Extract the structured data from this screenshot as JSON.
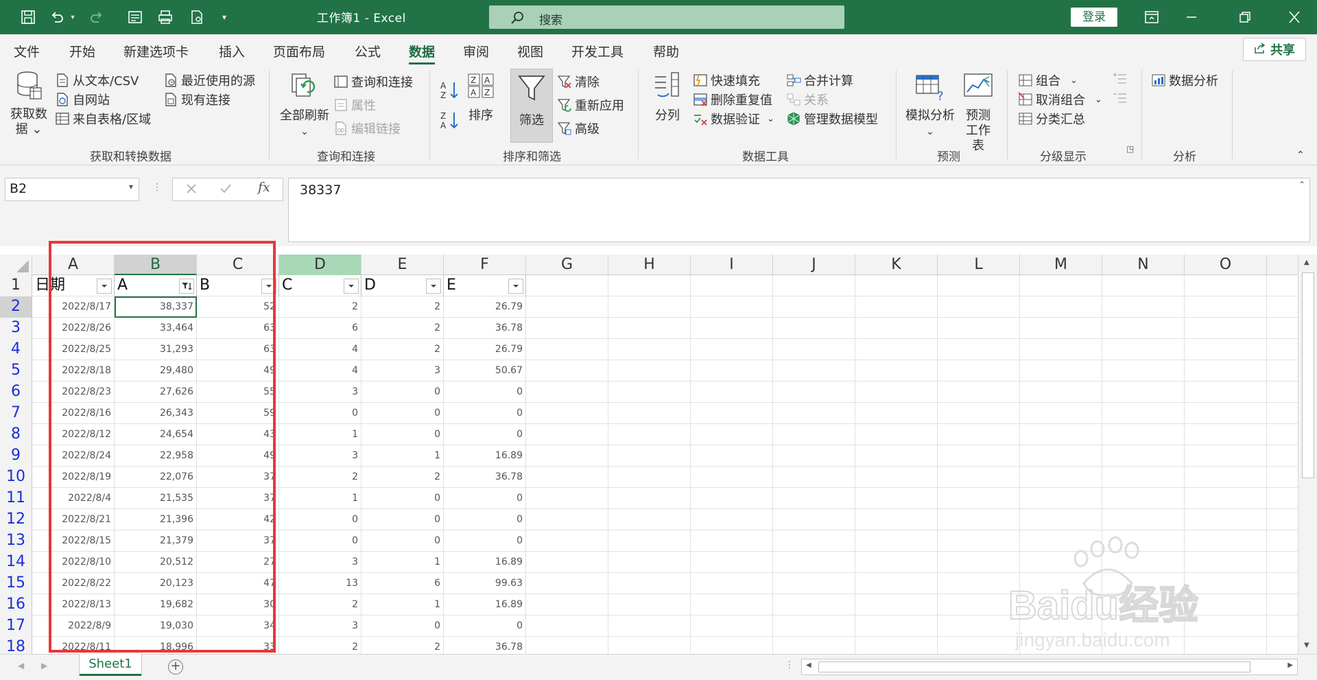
{
  "titlebar": {
    "doc_title": "工作簿1  -  Excel",
    "search_placeholder": "搜索",
    "login": "登录"
  },
  "tabs": [
    "文件",
    "开始",
    "新建选项卡",
    "插入",
    "页面布局",
    "公式",
    "数据",
    "审阅",
    "视图",
    "开发工具",
    "帮助"
  ],
  "active_tab": "数据",
  "share": "共享",
  "ribbon": {
    "get_data": "获取数\n据",
    "from_text": "从文本/CSV",
    "from_web": "自网站",
    "from_table": "来自表格/区域",
    "recent_sources": "最近使用的源",
    "existing_conn": "现有连接",
    "group_get": "获取和转换数据",
    "refresh_all": "全部刷新",
    "queries_conn": "查询和连接",
    "properties": "属性",
    "edit_links": "编辑链接",
    "group_query": "查询和连接",
    "sort": "排序",
    "filter": "筛选",
    "clear": "清除",
    "reapply": "重新应用",
    "advanced": "高级",
    "group_sort": "排序和筛选",
    "text_to_cols": "分列",
    "flash_fill": "快速填充",
    "remove_dup": "删除重复值",
    "data_valid": "数据验证",
    "consolidate": "合并计算",
    "relations": "关系",
    "manage_model": "管理数据模型",
    "group_tools": "数据工具",
    "whatif": "模拟分析",
    "forecast": "预测\n工作表",
    "group_forecast": "预测",
    "group_btn": "组合",
    "ungroup": "取消组合",
    "subtotal": "分类汇总",
    "group_outline": "分级显示",
    "data_analysis": "数据分析",
    "group_analysis": "分析"
  },
  "formula_bar": {
    "name_box": "B2",
    "fx": "fx",
    "value": "38337"
  },
  "columns": [
    "A",
    "B",
    "C",
    "D",
    "E",
    "F",
    "G",
    "H",
    "I",
    "J",
    "K",
    "L",
    "M",
    "N",
    "O"
  ],
  "header_row": [
    "日期",
    "A",
    "B",
    "C",
    "D",
    "E"
  ],
  "rows": [
    [
      "2022/8/17",
      "38,337",
      "52",
      "2",
      "2",
      "26.79"
    ],
    [
      "2022/8/26",
      "33,464",
      "63",
      "6",
      "2",
      "36.78"
    ],
    [
      "2022/8/25",
      "31,293",
      "63",
      "4",
      "2",
      "26.79"
    ],
    [
      "2022/8/18",
      "29,480",
      "49",
      "4",
      "3",
      "50.67"
    ],
    [
      "2022/8/23",
      "27,626",
      "55",
      "3",
      "0",
      "0"
    ],
    [
      "2022/8/16",
      "26,343",
      "59",
      "0",
      "0",
      "0"
    ],
    [
      "2022/8/12",
      "24,654",
      "43",
      "1",
      "0",
      "0"
    ],
    [
      "2022/8/24",
      "22,958",
      "49",
      "3",
      "1",
      "16.89"
    ],
    [
      "2022/8/19",
      "22,076",
      "37",
      "2",
      "2",
      "36.78"
    ],
    [
      "2022/8/4",
      "21,535",
      "37",
      "1",
      "0",
      "0"
    ],
    [
      "2022/8/21",
      "21,396",
      "42",
      "0",
      "0",
      "0"
    ],
    [
      "2022/8/15",
      "21,379",
      "37",
      "0",
      "0",
      "0"
    ],
    [
      "2022/8/10",
      "20,512",
      "27",
      "3",
      "1",
      "16.89"
    ],
    [
      "2022/8/22",
      "20,123",
      "47",
      "13",
      "6",
      "99.63"
    ],
    [
      "2022/8/13",
      "19,682",
      "30",
      "2",
      "1",
      "16.89"
    ],
    [
      "2022/8/9",
      "19,030",
      "34",
      "3",
      "0",
      "0"
    ],
    [
      "2022/8/11",
      "18,996",
      "33",
      "2",
      "2",
      "36.78"
    ]
  ],
  "sheet_tab": "Sheet1",
  "watermark": "Baidu经验",
  "watermark_url": "jingyan.baidu.com"
}
